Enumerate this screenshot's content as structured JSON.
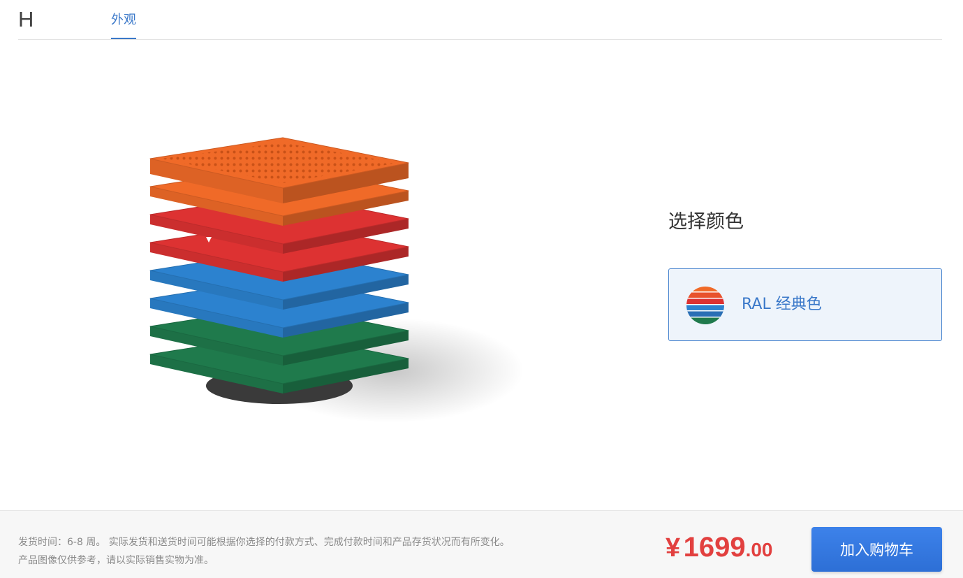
{
  "header": {
    "brand": "H",
    "tabs": [
      {
        "label": "外观",
        "active": true
      }
    ]
  },
  "product": {
    "layers": [
      "orange-top",
      "orange",
      "red",
      "red",
      "blue",
      "blue",
      "green",
      "green"
    ],
    "colors": {
      "orange": "#f06a28",
      "red": "#dd3232",
      "blue": "#2c82cf",
      "green": "#1f7a4c"
    }
  },
  "options": {
    "title": "选择颜色",
    "selected": {
      "label": "RAL 经典色",
      "swatch_icon": "ral-palette-icon"
    }
  },
  "footer": {
    "ship_line1": "发货时间：6-8 周。 实际发货和送货时间可能根据你选择的付款方式、完成付款时间和产品存货状况而有所变化。",
    "ship_line2": "产品图像仅供参考，请以实际销售实物为准。",
    "price": {
      "currency": "¥",
      "integer": "1699",
      "decimal": ".00"
    },
    "cart_label": "加入购物车"
  },
  "accent": {
    "link_blue": "#3a78c9",
    "price_red": "#e2403f",
    "button_blue": "#3379e3"
  }
}
